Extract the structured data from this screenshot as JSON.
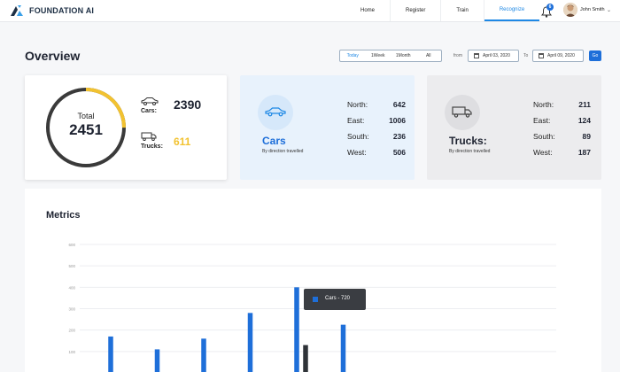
{
  "brand": {
    "name": "FOUNDATION AI"
  },
  "nav": {
    "links": [
      {
        "label": "Home"
      },
      {
        "label": "Register"
      },
      {
        "label": "Train"
      },
      {
        "label": "Recognize",
        "active": true
      }
    ],
    "notification_count": "6",
    "user_name": "John Smith",
    "icons": {
      "notifications": "bell-icon",
      "user_menu": "chevron-down-icon"
    }
  },
  "overview": {
    "title": "Overview",
    "range_buttons": [
      "Today",
      "1Week",
      "1Month",
      "All"
    ],
    "from_label": "from",
    "from_date": "April 03, 2020",
    "to_label": "To",
    "to_date": "April 09, 2020",
    "go_label": "Go"
  },
  "total_card": {
    "label": "Total",
    "value": "2451",
    "cars_label": "Cars:",
    "cars_value": "2390",
    "trucks_label": "Trucks:",
    "trucks_value": "611",
    "ring_fraction_yellow": 0.25,
    "colors": {
      "yellow": "#f2c230",
      "dark": "#3a3a3a"
    }
  },
  "cars_card": {
    "name": "Cars",
    "subtitle": "By direction travelled",
    "directions": [
      {
        "label": "North:",
        "value": "642"
      },
      {
        "label": "East:",
        "value": "1006"
      },
      {
        "label": "South:",
        "value": "236"
      },
      {
        "label": "West:",
        "value": "506"
      }
    ]
  },
  "trucks_card": {
    "name": "Trucks:",
    "subtitle": "By direction travelled",
    "directions": [
      {
        "label": "North:",
        "value": "211"
      },
      {
        "label": "East:",
        "value": "124"
      },
      {
        "label": "South:",
        "value": "89"
      },
      {
        "label": "West:",
        "value": "187"
      }
    ]
  },
  "metrics": {
    "title": "Metrics",
    "tooltip": "Cars - 720",
    "colors": {
      "cars": "#1e6fd9",
      "trucks": "#2f3338"
    }
  },
  "chart_data": {
    "type": "bar",
    "ylim": [
      0,
      600
    ],
    "yticks": [
      "600",
      "500",
      "400",
      "300",
      "200",
      "100"
    ],
    "series": [
      {
        "values": [
          170,
          110,
          160,
          280,
          400,
          225
        ]
      },
      {
        "values": [
          null,
          null,
          null,
          null,
          130,
          null
        ]
      }
    ]
  }
}
